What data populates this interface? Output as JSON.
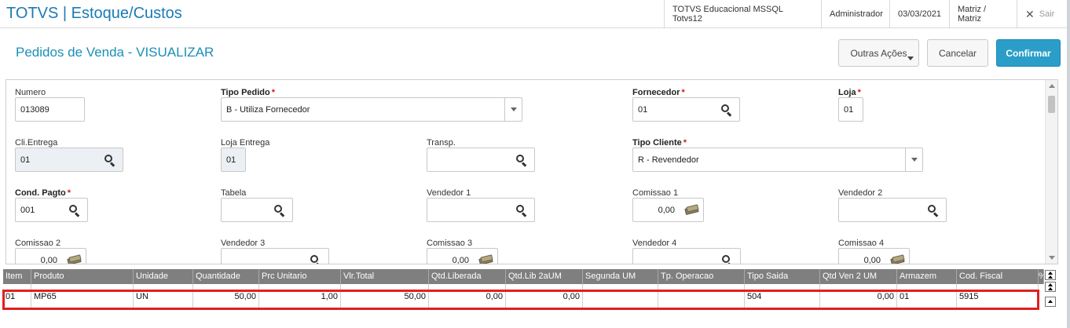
{
  "app": {
    "title": "TOTVS | Estoque/Custos",
    "environment": "TOTVS Educacional MSSQL Totvs12",
    "user": "Administrador",
    "date": "03/03/2021",
    "branch": "Matriz / Matriz",
    "exit_label": "Sair"
  },
  "page": {
    "title": "Pedidos de Venda - VISUALIZAR",
    "actions": {
      "more_label": "Outras Ações",
      "cancel_label": "Cancelar",
      "confirm_label": "Confirmar"
    }
  },
  "form": {
    "numero": {
      "label": "Numero",
      "value": "013089"
    },
    "tipo_pedido": {
      "label": "Tipo Pedido",
      "value": "B - Utiliza Fornecedor",
      "required": "*"
    },
    "fornecedor": {
      "label": "Fornecedor",
      "value": "01",
      "required": "*"
    },
    "loja": {
      "label": "Loja",
      "value": "01",
      "required": "*"
    },
    "cli_entrega": {
      "label": "Cli.Entrega",
      "value": "01"
    },
    "loja_entrega": {
      "label": "Loja Entrega",
      "value": "01"
    },
    "transp": {
      "label": "Transp.",
      "value": ""
    },
    "tipo_cliente": {
      "label": "Tipo Cliente",
      "value": "R - Revendedor",
      "required": "*"
    },
    "cond_pagto": {
      "label": "Cond. Pagto",
      "value": "001",
      "required": "*"
    },
    "tabela": {
      "label": "Tabela",
      "value": ""
    },
    "vendedor1": {
      "label": "Vendedor 1",
      "value": ""
    },
    "comissao1": {
      "label": "Comissao 1",
      "value": "0,00"
    },
    "vendedor2": {
      "label": "Vendedor 2",
      "value": ""
    },
    "comissao2": {
      "label": "Comissao 2",
      "value": "0,00"
    },
    "vendedor3": {
      "label": "Vendedor 3",
      "value": ""
    },
    "comissao3": {
      "label": "Comissao 3",
      "value": "0,00"
    },
    "vendedor4": {
      "label": "Vendedor 4",
      "value": ""
    },
    "comissao4": {
      "label": "Comissao 4",
      "value": "0,00"
    }
  },
  "grid": {
    "columns": [
      "Item",
      "Produto",
      "Unidade",
      "Quantidade",
      "Prc Unitario",
      "Vlr.Total",
      "Qtd.Liberada",
      "Qtd.Lib 2aUM",
      "Segunda UM",
      "Tp. Operacao",
      "Tipo Saida",
      "Qtd Ven 2 UM",
      "Armazem",
      "Cod. Fiscal",
      "%"
    ],
    "rows": [
      [
        "01",
        "MP65",
        "UN",
        "50,00",
        "1,00",
        "50,00",
        "0,00",
        "0,00",
        "",
        "",
        "504",
        "0,00",
        "01",
        "5915",
        ""
      ]
    ],
    "highlight_color": "#e02020"
  }
}
